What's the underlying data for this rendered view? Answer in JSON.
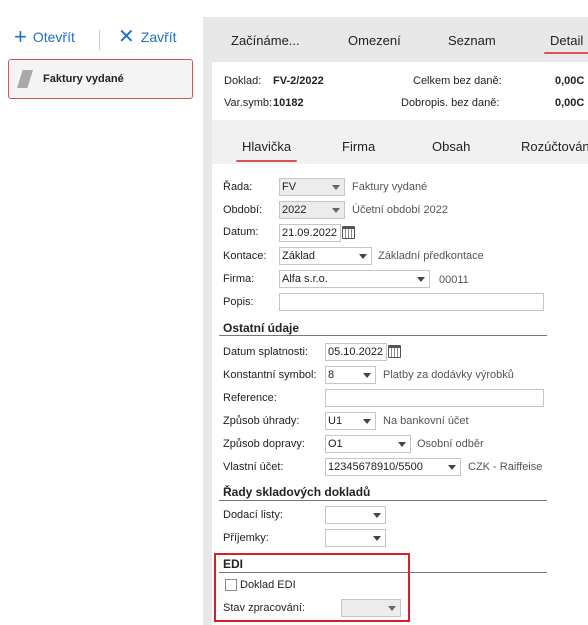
{
  "toolbar": {
    "open_label": "Otevřít",
    "close_label": "Zavřít",
    "open_icon": "plus-icon",
    "close_icon": "close-icon"
  },
  "left_panel": {
    "items": [
      {
        "label": "Faktury vydané",
        "icon": "document-icon"
      }
    ]
  },
  "main_tabs": [
    "Začínáme...",
    "Omezení",
    "Seznam",
    "Detail"
  ],
  "header": {
    "doklad_label": "Doklad:",
    "doklad_value": "FV-2/2022",
    "varsymb_label": "Var.symb:",
    "varsymb_value": "10182",
    "celkem_label": "Celkem bez daně:",
    "celkem_value": "0,00C",
    "dobropis_label": "Dobropis. bez daně:",
    "dobropis_value": "0,00C"
  },
  "sub_tabs": [
    "Hlavička",
    "Firma",
    "Obsah",
    "Rozúčtování"
  ],
  "form": {
    "rada": {
      "label": "Řada:",
      "value": "FV",
      "desc": "Faktury vydané"
    },
    "obdobi": {
      "label": "Období:",
      "value": "2022",
      "desc": "Účetní období 2022"
    },
    "datum": {
      "label": "Datum:",
      "value": "21.09.2022"
    },
    "kontace": {
      "label": "Kontace:",
      "value": "Základ",
      "desc": "Základní předkontace"
    },
    "firma": {
      "label": "Firma:",
      "value": "Alfa s.r.o.",
      "desc": "00011"
    },
    "popis": {
      "label": "Popis:",
      "value": ""
    }
  },
  "ostatni": {
    "title": "Ostatní údaje",
    "splatnost": {
      "label": "Datum splatnosti:",
      "value": "05.10.2022"
    },
    "konst_symbol": {
      "label": "Konstantní symbol:",
      "value": "8",
      "desc": "Platby za dodávky výrobků"
    },
    "reference": {
      "label": "Reference:",
      "value": ""
    },
    "zpusob_uhrady": {
      "label": "Způsob úhrady:",
      "value": "U1",
      "desc": "Na bankovní účet"
    },
    "zpusob_dopravy": {
      "label": "Způsob dopravy:",
      "value": "O1",
      "desc": "Osobní odběr"
    },
    "vlastni_ucet": {
      "label": "Vlastní účet:",
      "value": "12345678910/5500",
      "desc": "CZK - Raiffeise"
    }
  },
  "rady_sklad": {
    "title": "Řady skladových dokladů",
    "dodaci": {
      "label": "Dodací listy:",
      "value": ""
    },
    "prijemky": {
      "label": "Příjemky:",
      "value": ""
    }
  },
  "edi": {
    "title": "EDI",
    "checkbox_label": "Doklad EDI",
    "checked": false,
    "stav_label": "Stav zpracování:",
    "stav_value": ""
  },
  "colors": {
    "accent": "#d9535a",
    "link_blue": "#1f6fc5",
    "highlight_box": "#d8202b",
    "panel_bg": "#e8e8e8"
  }
}
